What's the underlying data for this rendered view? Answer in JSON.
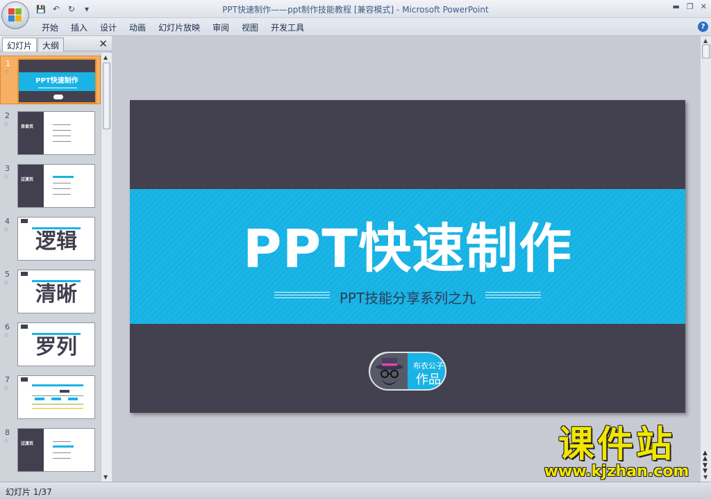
{
  "window": {
    "title": "PPT快速制作——ppt制作技能教程 [兼容模式]",
    "separator": " - ",
    "app_name": "Microsoft PowerPoint"
  },
  "quick_access": [
    {
      "icon": "save-icon",
      "glyph": "💾"
    },
    {
      "icon": "undo-icon",
      "glyph": "↶"
    },
    {
      "icon": "redo-icon",
      "glyph": "↻"
    },
    {
      "icon": "customize-icon",
      "glyph": "▾"
    }
  ],
  "ribbon": {
    "tabs": [
      "开始",
      "插入",
      "设计",
      "动画",
      "幻灯片放映",
      "审阅",
      "视图",
      "开发工具"
    ]
  },
  "left_pane": {
    "tab_slides": "幻灯片",
    "tab_outline": "大纲",
    "thumbnails": [
      {
        "num": "1",
        "text": "PPT快速制作"
      },
      {
        "num": "2",
        "text": "目录页"
      },
      {
        "num": "3",
        "text": "过渡页"
      },
      {
        "num": "4",
        "text": "逻辑"
      },
      {
        "num": "5",
        "text": "清晰"
      },
      {
        "num": "6",
        "text": "罗列"
      },
      {
        "num": "7",
        "text": ""
      },
      {
        "num": "8",
        "text": "过渡页"
      }
    ],
    "selected_index": 0
  },
  "slide": {
    "title": "PPT快速制作",
    "subtitle": "PPT技能分享系列之九",
    "badge_top": "布衣公子",
    "badge_bottom": "作品",
    "colors": {
      "background": "#43414f",
      "band": "#19b3e6",
      "subtitle": "#2d3b56"
    }
  },
  "status": {
    "slide_indicator": "幻灯片 1/37"
  },
  "watermark": {
    "cn": "课件站",
    "url": "www.kjzhan.com"
  }
}
